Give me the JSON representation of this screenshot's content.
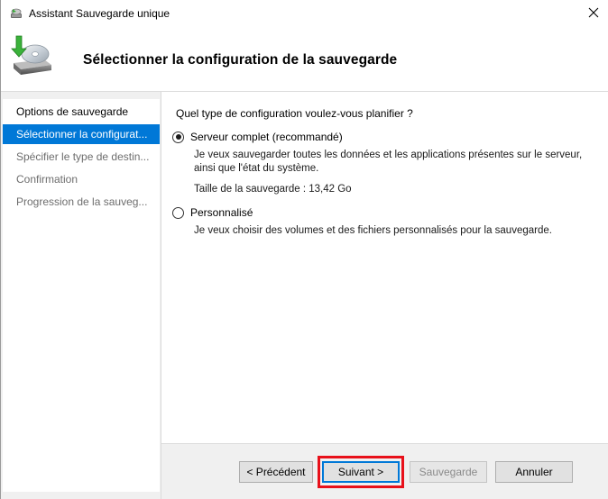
{
  "window": {
    "title": "Assistant Sauvegarde unique",
    "close_icon": "close-icon",
    "app_icon": "backup-app-icon"
  },
  "header": {
    "title": "Sélectionner la configuration de la sauvegarde",
    "icon": "backup-drive-icon"
  },
  "steps": [
    {
      "label": "Options de sauvegarde",
      "state": "done"
    },
    {
      "label": "Sélectionner la configurat...",
      "state": "active"
    },
    {
      "label": "Spécifier le type de destin...",
      "state": "pending"
    },
    {
      "label": "Confirmation",
      "state": "pending"
    },
    {
      "label": "Progression de la sauveg...",
      "state": "pending"
    }
  ],
  "content": {
    "question": "Quel type de configuration voulez-vous planifier ?",
    "options": [
      {
        "label": "Serveur complet (recommandé)",
        "checked": true,
        "description_line1": "Je veux sauvegarder toutes les données et les applications présentes sur le serveur,",
        "description_line2": "ainsi que l'état du système.",
        "size_text": "Taille de la sauvegarde : 13,42 Go"
      },
      {
        "label": "Personnalisé",
        "checked": false,
        "description_line1": "Je veux choisir des volumes et des fichiers personnalisés pour la sauvegarde."
      }
    ]
  },
  "footer": {
    "previous_label": "< Précédent",
    "next_label": "Suivant >",
    "backup_label": "Sauvegarde",
    "cancel_label": "Annuler",
    "highlight_color": "#e8101a",
    "accent_color": "#0078d7"
  }
}
